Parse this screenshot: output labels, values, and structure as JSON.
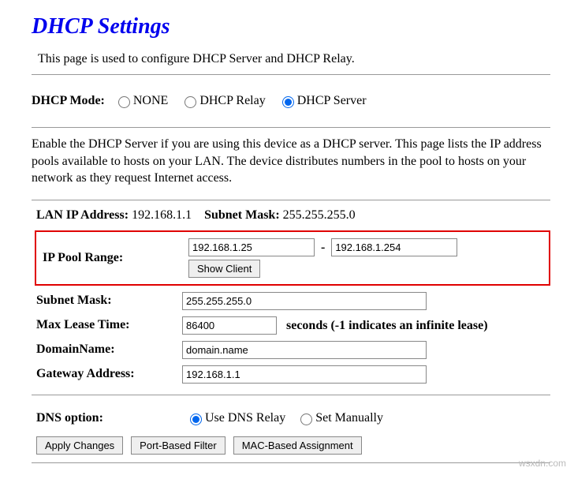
{
  "title": "DHCP Settings",
  "intro": "This page is used to configure DHCP Server and DHCP Relay.",
  "mode": {
    "label": "DHCP Mode:",
    "options": {
      "none": "NONE",
      "relay": "DHCP Relay",
      "server": "DHCP Server"
    },
    "selected": "server"
  },
  "description": "Enable the DHCP Server if you are using this device as a DHCP server. This page lists the IP address pools available to hosts on your LAN. The device distributes numbers in the pool to hosts on your network as they request Internet access.",
  "lan": {
    "ip_label": "LAN IP Address:",
    "ip": "192.168.1.1",
    "mask_label": "Subnet Mask:",
    "mask": "255.255.255.0"
  },
  "pool": {
    "label": "IP Pool Range:",
    "start": "192.168.1.25",
    "end": "192.168.1.254",
    "show_client": "Show Client"
  },
  "fields": {
    "subnet_mask": {
      "label": "Subnet Mask:",
      "value": "255.255.255.0"
    },
    "max_lease": {
      "label": "Max Lease Time:",
      "value": "86400",
      "suffix": "seconds (-1 indicates an infinite lease)"
    },
    "domain": {
      "label": "DomainName:",
      "value": "domain.name"
    },
    "gateway": {
      "label": "Gateway Address:",
      "value": "192.168.1.1"
    }
  },
  "dns": {
    "label": "DNS option:",
    "relay": "Use DNS Relay",
    "manual": "Set Manually",
    "selected": "relay"
  },
  "buttons": {
    "apply": "Apply Changes",
    "port_filter": "Port-Based Filter",
    "mac_assign": "MAC-Based Assignment"
  },
  "watermark": "wsxdn.com"
}
